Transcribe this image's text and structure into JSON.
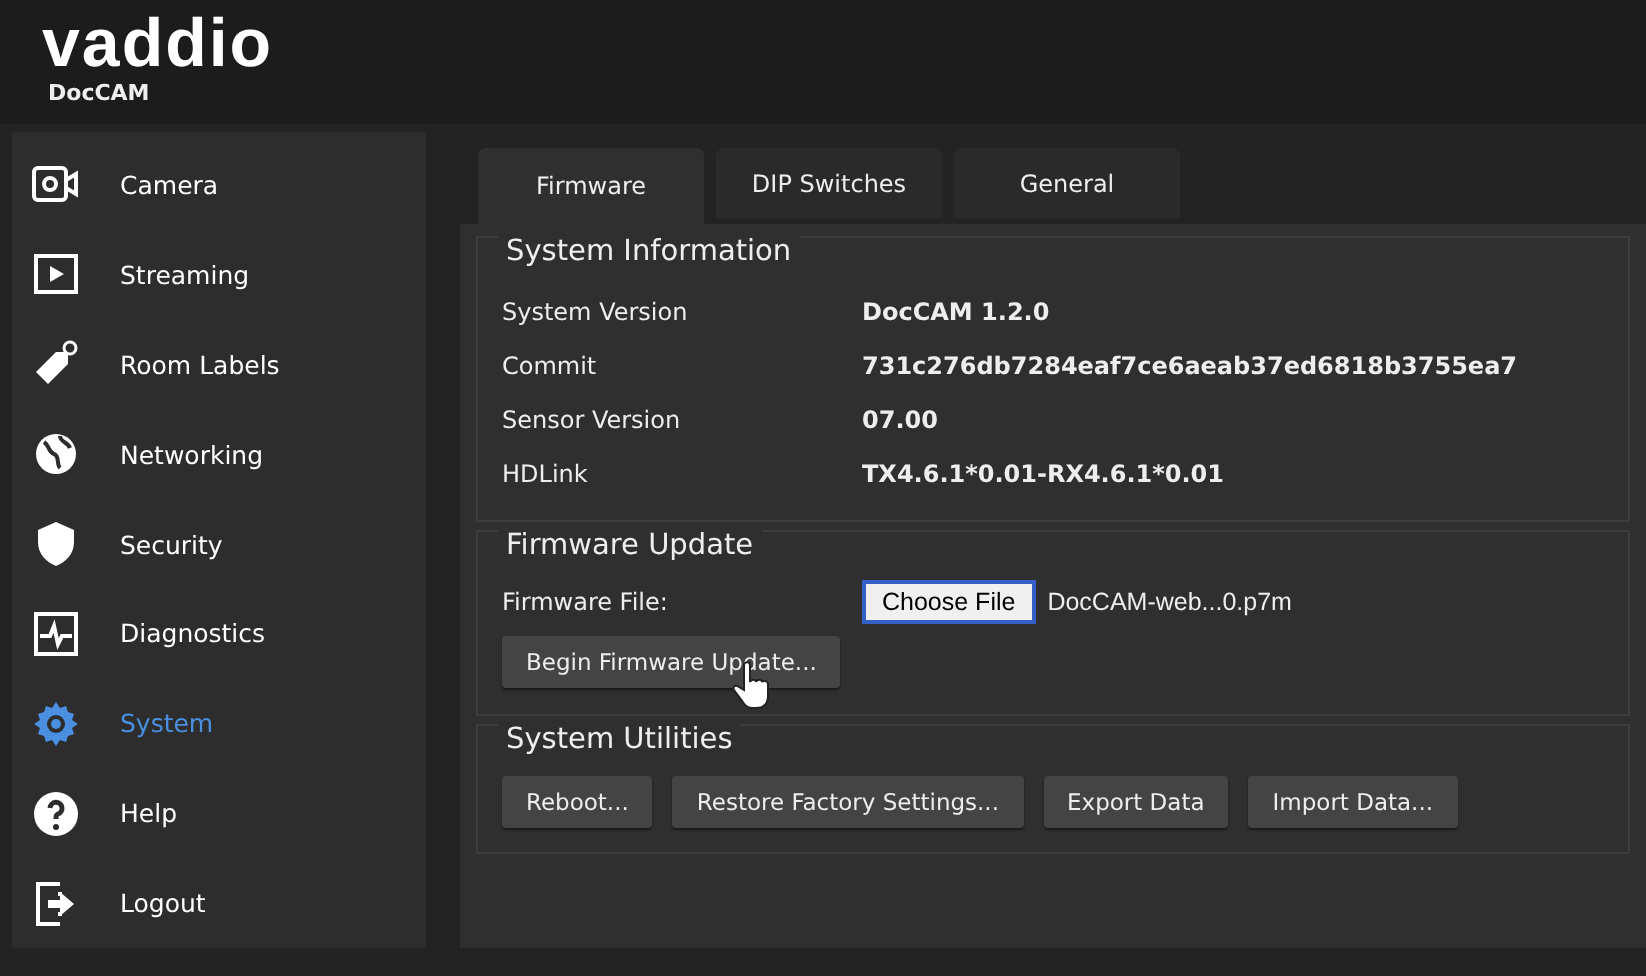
{
  "header": {
    "logo": "vaddio",
    "product": "DocCAM"
  },
  "sidebar": {
    "items": [
      {
        "label": "Camera",
        "selected": false
      },
      {
        "label": "Streaming",
        "selected": false
      },
      {
        "label": "Room Labels",
        "selected": false
      },
      {
        "label": "Networking",
        "selected": false
      },
      {
        "label": "Security",
        "selected": false
      },
      {
        "label": "Diagnostics",
        "selected": false
      },
      {
        "label": "System",
        "selected": true
      },
      {
        "label": "Help",
        "selected": false
      },
      {
        "label": "Logout",
        "selected": false
      }
    ]
  },
  "tabs": [
    {
      "label": "Firmware",
      "selected": true
    },
    {
      "label": "DIP Switches",
      "selected": false
    },
    {
      "label": "General",
      "selected": false
    }
  ],
  "system_information": {
    "title": "System Information",
    "rows": [
      {
        "label": "System Version",
        "value": "DocCAM 1.2.0"
      },
      {
        "label": "Commit",
        "value": "731c276db7284eaf7ce6aeab37ed6818b3755ea7"
      },
      {
        "label": "Sensor Version",
        "value": "07.00"
      },
      {
        "label": "HDLink",
        "value": "TX4.6.1*0.01-RX4.6.1*0.01"
      }
    ]
  },
  "firmware_update": {
    "title": "Firmware Update",
    "file_label": "Firmware File:",
    "choose_button": "Choose File",
    "file_name": "DocCAM-web...0.p7m",
    "begin_button": "Begin Firmware Update..."
  },
  "system_utilities": {
    "title": "System Utilities",
    "buttons": [
      "Reboot...",
      "Restore Factory Settings...",
      "Export Data",
      "Import Data..."
    ]
  }
}
